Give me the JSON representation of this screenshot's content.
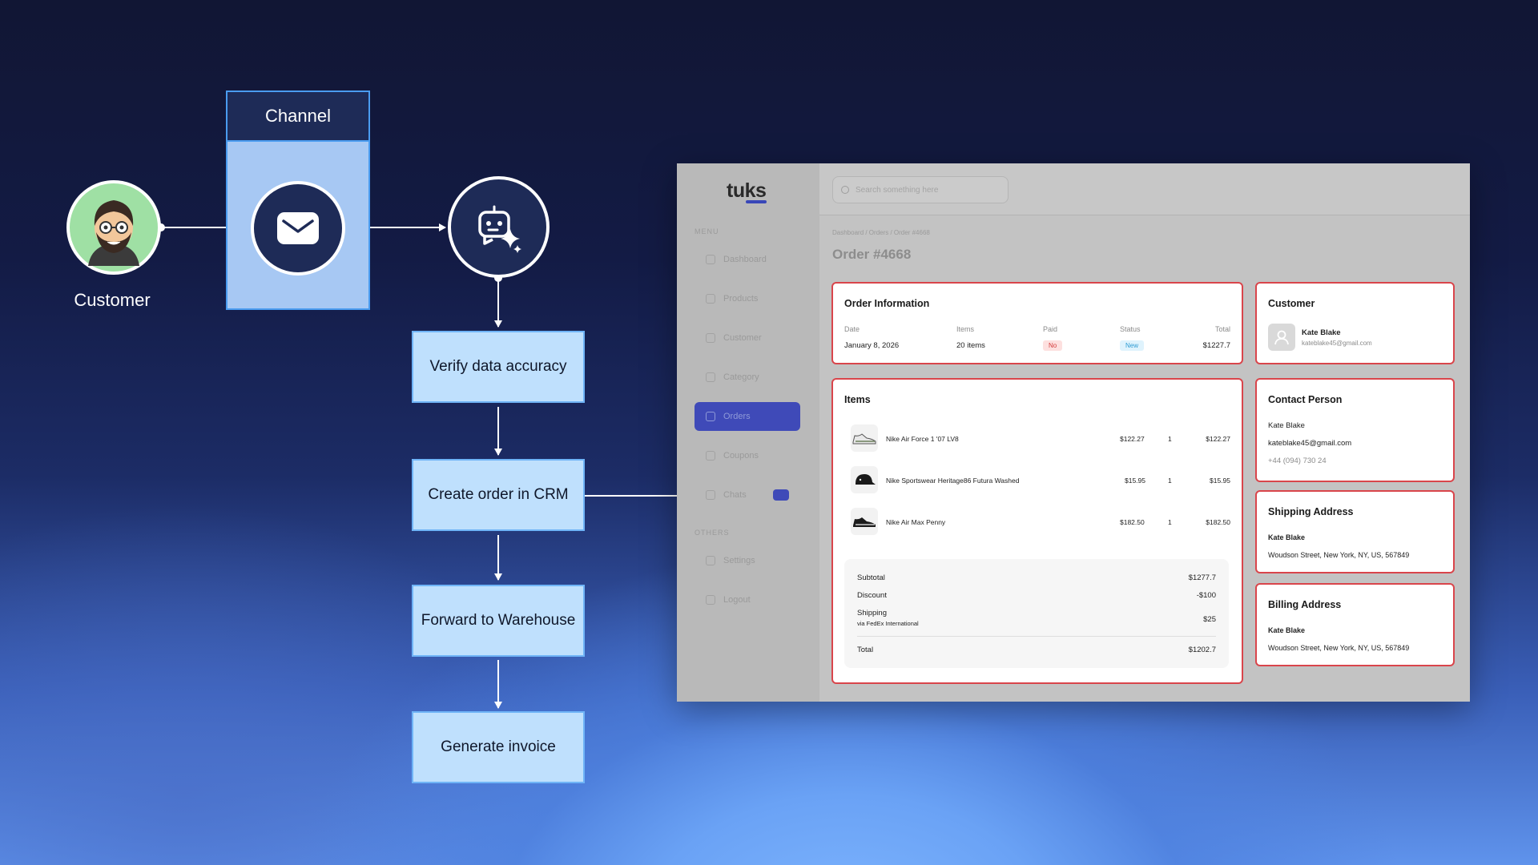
{
  "flow": {
    "customer_label": "Customer",
    "channel_label": "Channel",
    "steps": [
      "Verify data accuracy",
      "Create order in CRM",
      "Forward to Warehouse",
      "Generate invoice"
    ],
    "icons": {
      "customer": "customer-avatar-icon",
      "channel": "envelope-icon",
      "agent": "ai-bot-sparkle-icon"
    }
  },
  "crm": {
    "logo": "tuks",
    "search_placeholder": "Search something here",
    "sidebar": {
      "menu_label": "MENU",
      "items": [
        "Dashboard",
        "Products",
        "Customer",
        "Category",
        "Orders",
        "Coupons",
        "Chats"
      ],
      "active_item": "Orders",
      "others_label": "OTHERS",
      "other_items": [
        "Settings",
        "Logout"
      ]
    },
    "breadcrumb": "Dashboard / Orders / Order #4668",
    "order_title": "Order #4668",
    "order_info": {
      "title": "Order Information",
      "headers": [
        "Date",
        "Items",
        "Paid",
        "Status",
        "Total"
      ],
      "date": "January 8, 2026",
      "items": "20 items",
      "paid": "No",
      "status": "New",
      "total": "$1227.7"
    },
    "customer_card": {
      "title": "Customer",
      "name": "Kate Blake",
      "email": "kateblake45@gmail.com"
    },
    "items_card": {
      "title": "Items",
      "rows": [
        {
          "name": "Nike Air Force 1 '07 LV8",
          "price": "$122.27",
          "qty": "1",
          "total": "$122.27",
          "icon": "sneaker-white-icon"
        },
        {
          "name": "Nike Sportswear Heritage86 Futura Washed",
          "price": "$15.95",
          "qty": "1",
          "total": "$15.95",
          "icon": "cap-icon"
        },
        {
          "name": "Nike Air Max Penny",
          "price": "$182.50",
          "qty": "1",
          "total": "$182.50",
          "icon": "sneaker-black-icon"
        }
      ],
      "summary": {
        "subtotal_label": "Subtotal",
        "subtotal": "$1277.7",
        "discount_label": "Discount",
        "discount": "-$100",
        "shipping_label": "Shipping",
        "shipping": "$25",
        "shipping_note": "via FedEx International",
        "total_label": "Total",
        "total": "$1202.7"
      }
    },
    "contact_card": {
      "title": "Contact Person",
      "name": "Kate Blake",
      "email": "kateblake45@gmail.com",
      "phone": "+44 (094) 730 24"
    },
    "shipping_card": {
      "title": "Shipping Address",
      "name": "Kate Blake",
      "address": "Woudson Street, New York, NY, US, 567849"
    },
    "billing_card": {
      "title": "Billing Address",
      "name": "Kate Blake",
      "address": "Woudson Street, New York, NY, US, 567849"
    }
  }
}
